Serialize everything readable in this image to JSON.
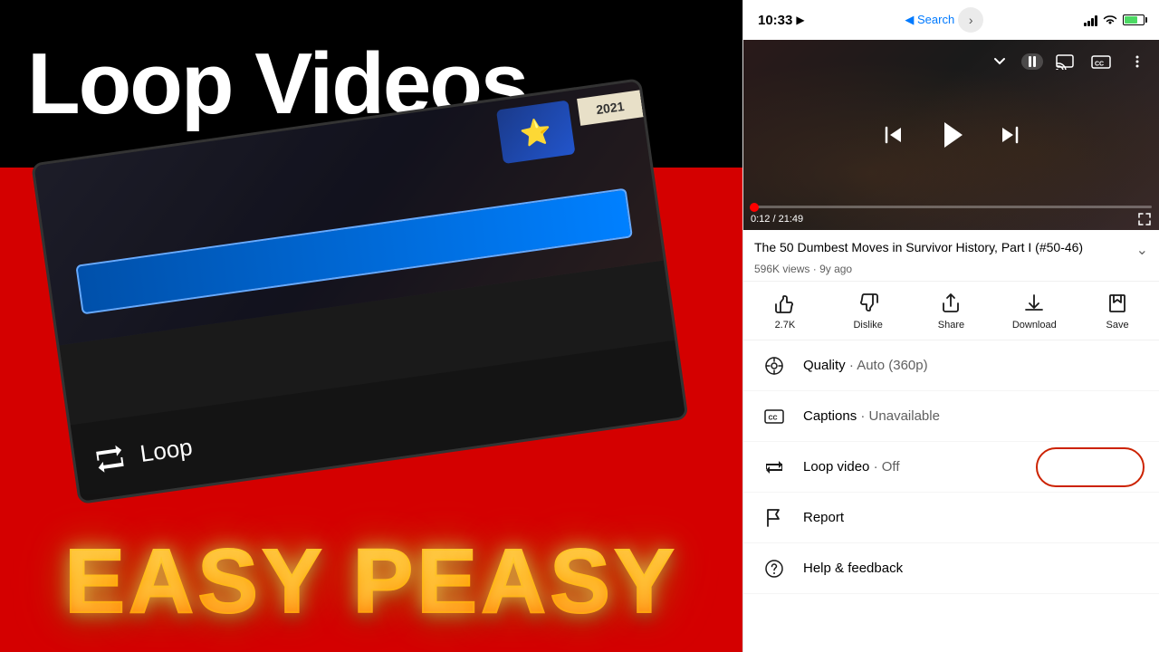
{
  "left": {
    "title": "Loop Videos",
    "subtitle": "EASY PEASY",
    "loop_label": "Loop"
  },
  "status_bar": {
    "time": "10:33",
    "location_arrow": "▶",
    "back_label": "◀ Search",
    "signal": "●●●●",
    "wifi": "wifi",
    "battery": "battery"
  },
  "video_player": {
    "current_time": "0:12",
    "total_time": "21:49"
  },
  "video_info": {
    "title": "The 50 Dumbest Moves in Survivor History, Part I (#50-46)",
    "views": "596K views",
    "age": "9y ago"
  },
  "actions": [
    {
      "icon": "👍",
      "label": "2.7K"
    },
    {
      "icon": "👎",
      "label": "Dislike"
    },
    {
      "icon": "↗",
      "label": "Share"
    },
    {
      "icon": "⬇",
      "label": "Download"
    },
    {
      "icon": "✚",
      "label": "Save"
    }
  ],
  "menu_items": [
    {
      "id": "quality",
      "label": "Quality",
      "value": "Auto (360p)"
    },
    {
      "id": "captions",
      "label": "Captions",
      "value": "Unavailable"
    },
    {
      "id": "loop",
      "label": "Loop video",
      "value": "Off"
    },
    {
      "id": "report",
      "label": "Report",
      "value": ""
    },
    {
      "id": "help",
      "label": "Help & feedback",
      "value": ""
    }
  ]
}
